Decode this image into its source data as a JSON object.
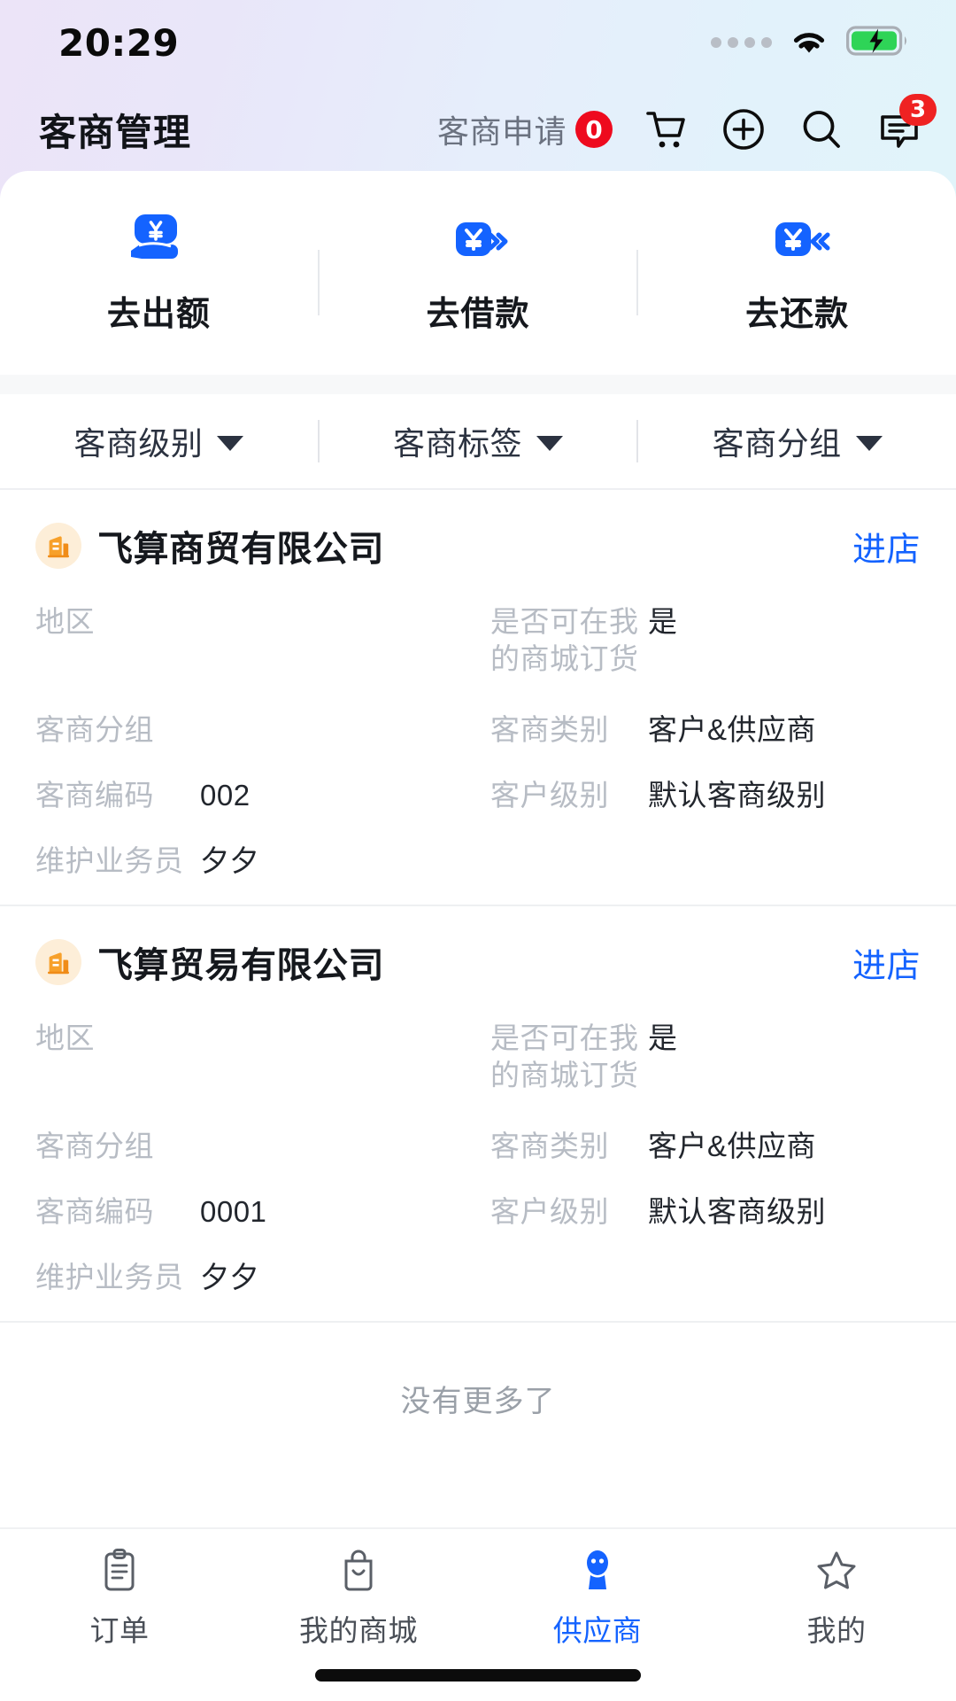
{
  "status_bar": {
    "time": "20:29",
    "icons": [
      "signal-dots-icon",
      "wifi-icon",
      "battery-charging-icon"
    ]
  },
  "header": {
    "title": "客商管理",
    "apply_label": "客商申请",
    "apply_badge": "0",
    "actions": [
      {
        "name": "cart-icon",
        "label": "购物车"
      },
      {
        "name": "plus-circle-icon",
        "label": "新增"
      },
      {
        "name": "search-icon",
        "label": "搜索"
      },
      {
        "name": "message-icon",
        "label": "消息",
        "badge": "3"
      }
    ]
  },
  "quick_actions": [
    {
      "icon": "hand-yuan-icon",
      "label": "去出额"
    },
    {
      "icon": "yuan-out-icon",
      "label": "去借款"
    },
    {
      "icon": "yuan-in-icon",
      "label": "去还款"
    }
  ],
  "filters": [
    {
      "label": "客商级别",
      "icon": "chevron-down-icon"
    },
    {
      "label": "客商标签",
      "icon": "chevron-down-icon"
    },
    {
      "label": "客商分组",
      "icon": "chevron-down-icon"
    }
  ],
  "list": {
    "enter_shop_label": "进店",
    "no_more_text": "没有更多了",
    "labels": {
      "region": "地区",
      "can_order": "是否可在我的商城订货",
      "group": "客商分组",
      "category": "客商类别",
      "code": "客商编码",
      "level": "客户级别",
      "salesperson": "维护业务员"
    },
    "items": [
      {
        "name": "飞算商贸有限公司",
        "avatar_icon": "building-icon",
        "region": "",
        "can_order": "是",
        "group": "",
        "category": "客户&供应商",
        "code": "002",
        "level": "默认客商级别",
        "salesperson": "夕夕"
      },
      {
        "name": "飞算贸易有限公司",
        "avatar_icon": "building-icon",
        "region": "",
        "can_order": "是",
        "group": "",
        "category": "客户&供应商",
        "code": "0001",
        "level": "默认客商级别",
        "salesperson": "夕夕"
      }
    ]
  },
  "tabbar": {
    "items": [
      {
        "label": "订单",
        "icon": "clipboard-icon",
        "active": false
      },
      {
        "label": "我的商城",
        "icon": "shopping-bag-icon",
        "active": false
      },
      {
        "label": "供应商",
        "icon": "person-icon",
        "active": true
      },
      {
        "label": "我的",
        "icon": "star-icon",
        "active": false
      }
    ]
  },
  "colors": {
    "accent": "#1463ff",
    "badge_red": "#ee0a1e",
    "avatar_orange": "#f7a02a",
    "label_grey": "#b7bcc4",
    "gradient_left": "#ece4f8",
    "gradient_right": "#e1f4fa"
  }
}
